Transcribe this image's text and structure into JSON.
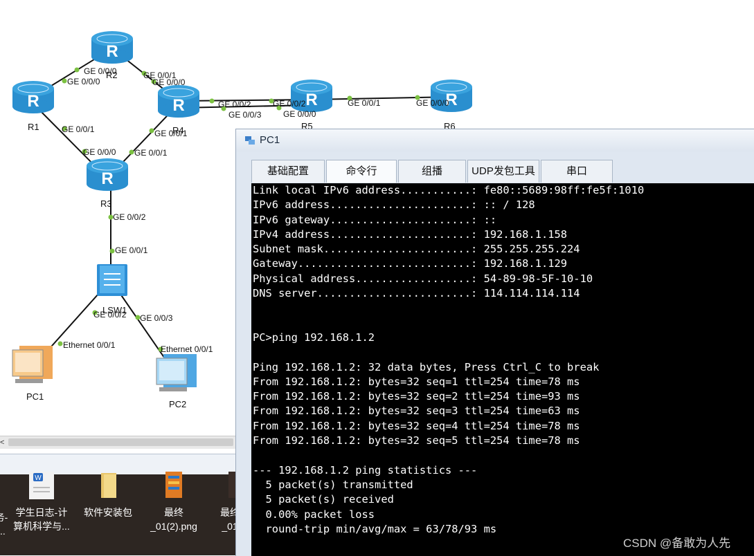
{
  "topology": {
    "devices": [
      {
        "id": "R1",
        "label": "R1",
        "kind": "router"
      },
      {
        "id": "R2",
        "label": "R2",
        "kind": "router"
      },
      {
        "id": "R3",
        "label": "R3",
        "kind": "router"
      },
      {
        "id": "R4",
        "label": "R4",
        "kind": "router"
      },
      {
        "id": "R5",
        "label": "R5",
        "kind": "router"
      },
      {
        "id": "R6",
        "label": "R6",
        "kind": "router"
      },
      {
        "id": "LSW1",
        "label": "LSW1",
        "kind": "switch"
      },
      {
        "id": "PC1",
        "label": "PC1",
        "kind": "pc"
      },
      {
        "id": "PC2",
        "label": "PC2",
        "kind": "pc"
      }
    ],
    "ports": [
      {
        "id": "p1",
        "text": "GE 0/0/0"
      },
      {
        "id": "p2",
        "text": "GE 0/0/0"
      },
      {
        "id": "p3",
        "text": "GE 0/0/1"
      },
      {
        "id": "p4",
        "text": "GE 0/0/0"
      },
      {
        "id": "p5",
        "text": "GE 0/0/1"
      },
      {
        "id": "p6",
        "text": "GE 0/0/0"
      },
      {
        "id": "p7",
        "text": "GE 0/0/1"
      },
      {
        "id": "p8",
        "text": "GE 0/0/1"
      },
      {
        "id": "p9",
        "text": "GE 0/0/2"
      },
      {
        "id": "p10",
        "text": "GE 0/0/3"
      },
      {
        "id": "p11",
        "text": "GE 0/0/2"
      },
      {
        "id": "p12",
        "text": "GE 0/0/0"
      },
      {
        "id": "p13",
        "text": "GE 0/0/1"
      },
      {
        "id": "p14",
        "text": "GE 0/0/0"
      },
      {
        "id": "p15",
        "text": "GE 0/0/2"
      },
      {
        "id": "p16",
        "text": "GE 0/0/1"
      },
      {
        "id": "p17",
        "text": "GE 0/0/2"
      },
      {
        "id": "p18",
        "text": "GE 0/0/3"
      },
      {
        "id": "p19",
        "text": "Ethernet 0/0/1"
      },
      {
        "id": "p20",
        "text": "Ethernet 0/0/1"
      }
    ],
    "colors": {
      "router": "#3aa3de",
      "link": "#111111",
      "port_dot": "#7cc142"
    }
  },
  "window": {
    "title": "PC1",
    "tabs": [
      "基础配置",
      "命令行",
      "组播",
      "UDP发包工具",
      "串口"
    ],
    "active_tab": "命令行"
  },
  "console": {
    "lines": [
      "Link local IPv6 address...........: fe80::5689:98ff:fe5f:1010",
      "IPv6 address......................: :: / 128",
      "IPv6 gateway......................: ::",
      "IPv4 address......................: 192.168.1.158",
      "Subnet mask.......................: 255.255.255.224",
      "Gateway...........................: 192.168.1.129",
      "Physical address..................: 54-89-98-5F-10-10",
      "DNS server........................: 114.114.114.114",
      "",
      "",
      "PC>ping 192.168.1.2",
      "",
      "Ping 192.168.1.2: 32 data bytes, Press Ctrl_C to break",
      "From 192.168.1.2: bytes=32 seq=1 ttl=254 time=78 ms",
      "From 192.168.1.2: bytes=32 seq=2 ttl=254 time=93 ms",
      "From 192.168.1.2: bytes=32 seq=3 ttl=254 time=63 ms",
      "From 192.168.1.2: bytes=32 seq=4 ttl=254 time=78 ms",
      "From 192.168.1.2: bytes=32 seq=5 ttl=254 time=78 ms",
      "",
      "--- 192.168.1.2 ping statistics ---",
      "  5 packet(s) transmitted",
      "  5 packet(s) received",
      "  0.00% packet loss",
      "  round-trip min/avg/max = 63/78/93 ms"
    ]
  },
  "desktop": {
    "icons": [
      {
        "line1": "务-",
        "line2": "..."
      },
      {
        "line1": "学生日志-计",
        "line2": "算机科学与..."
      },
      {
        "line1": "软件安装包",
        "line2": ""
      },
      {
        "line1": "最终",
        "line2": "_01(2).png"
      },
      {
        "line1": "最终",
        "line2": "_01"
      }
    ]
  },
  "scroll_arrow": "<",
  "watermark": "CSDN @备敢为人先"
}
